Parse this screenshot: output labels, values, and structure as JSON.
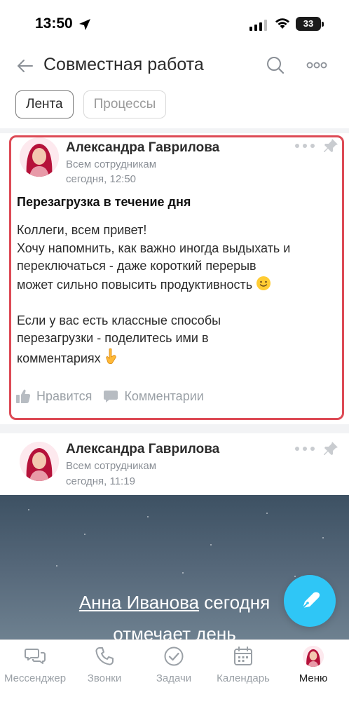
{
  "status_bar": {
    "time": "13:50",
    "battery": "33"
  },
  "header": {
    "title": "Совместная работа"
  },
  "tabs": [
    {
      "label": "Лента",
      "active": true
    },
    {
      "label": "Процессы",
      "active": false
    }
  ],
  "posts": [
    {
      "author": "Александра Гаврилова",
      "audience": "Всем сотрудникам",
      "time": "сегодня, 12:50",
      "title": "Перезагрузка в течение дня",
      "body_lines": [
        "Коллеги, всем привет!",
        "Хочу напомнить, как важно иногда выдыхать и",
        "переключаться - даже короткий перерыв",
        "может сильно повысить продуктивность",
        "",
        "Если у вас есть классные способы",
        "перезагрузки - поделитесь ими в",
        "комментариях"
      ],
      "like_label": "Нравится",
      "comment_label": "Комментарии"
    },
    {
      "author": "Александра Гаврилова",
      "audience": "Всем сотрудникам",
      "time": "сегодня, 11:19",
      "banner_link": "Анна Иванова",
      "banner_text_1": " сегодня",
      "banner_text_2": "отмечает день"
    }
  ],
  "bottom_nav": [
    {
      "label": "Мессенджер",
      "icon": "messenger-icon"
    },
    {
      "label": "Звонки",
      "icon": "phone-icon"
    },
    {
      "label": "Задачи",
      "icon": "tasks-check-icon"
    },
    {
      "label": "Календарь",
      "icon": "calendar-icon"
    },
    {
      "label": "Меню",
      "icon": "avatar",
      "active": true
    }
  ],
  "colors": {
    "accent": "#2fc6f6",
    "highlight_border": "#dd4a55",
    "muted": "#9aa0a6",
    "feed_bg": "#f2f3f5"
  }
}
